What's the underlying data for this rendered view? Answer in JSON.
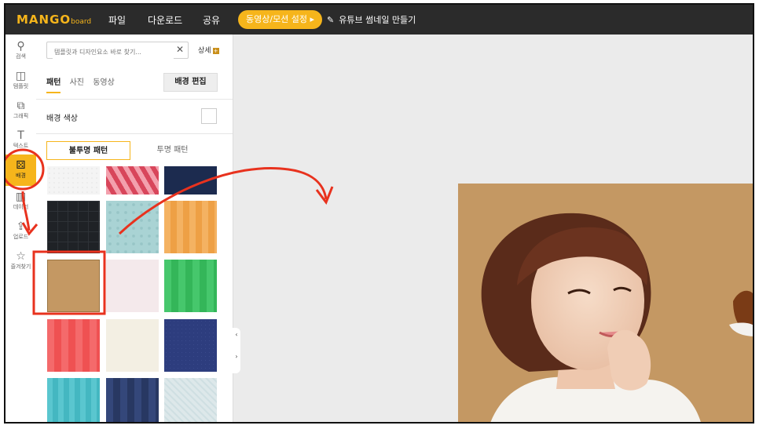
{
  "topbar": {
    "logo_main": "MANGO",
    "logo_sub": "board",
    "menu": [
      "파일",
      "다운로드",
      "공유"
    ],
    "motion_button": "동영상/모션 설정 ▸",
    "doc_title": "유튜브 썸네일 만들기"
  },
  "rail": {
    "items": [
      {
        "label": "검색",
        "icon": "search-icon"
      },
      {
        "label": "템플릿",
        "icon": "template-icon"
      },
      {
        "label": "그래픽",
        "icon": "graphic-icon"
      },
      {
        "label": "텍스트",
        "icon": "text-icon"
      },
      {
        "label": "배경",
        "icon": "background-icon"
      },
      {
        "label": "데이터",
        "icon": "chart-icon"
      },
      {
        "label": "업로드",
        "icon": "upload-icon"
      },
      {
        "label": "즐겨찾기",
        "icon": "star-icon"
      }
    ]
  },
  "panel": {
    "search_placeholder": "템플릿과 디자인요소 바로 찾기...",
    "detail_label": "상세",
    "tabs": [
      "패턴",
      "사진",
      "동영상"
    ],
    "edit_button": "배경 편집",
    "bg_color_label": "배경 색상",
    "pattern_tabs": [
      "불투명 패턴",
      "투명 패턴"
    ]
  },
  "colors": {
    "accent": "#f6b51b",
    "topbar": "#2b2b2b",
    "annotation": "#e8321e"
  }
}
